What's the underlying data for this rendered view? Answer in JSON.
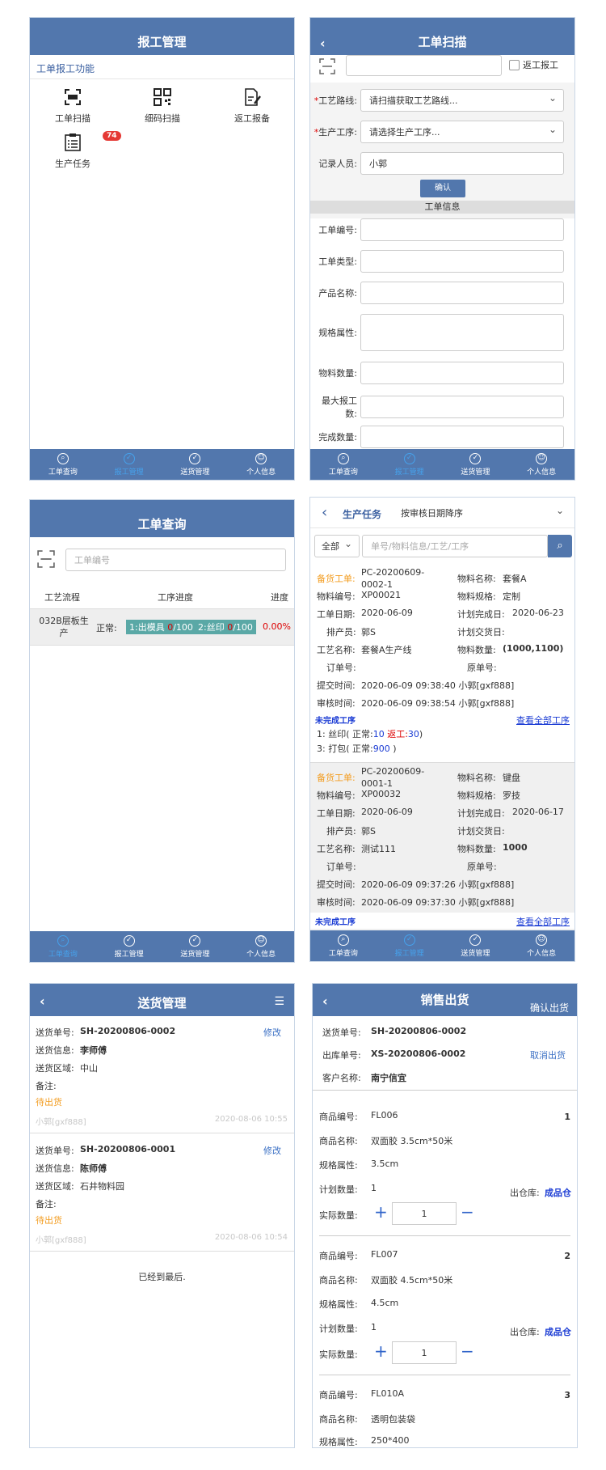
{
  "nav": {
    "tab1": "工单查询",
    "tab2": "报工管理",
    "tab3": "送货管理",
    "tab4": "个人信息"
  },
  "p1": {
    "title": "报工管理",
    "section": "工单报工功能",
    "icons": [
      {
        "label": "工单扫描"
      },
      {
        "label": "细码扫描"
      },
      {
        "label": "返工报备"
      },
      {
        "label": "生产任务",
        "badge": "74"
      }
    ]
  },
  "p2": {
    "title": "工单扫描",
    "rework": "返工报工",
    "route_label": "工艺路线:",
    "route_ph": "请扫描获取工艺路线...",
    "proc_label": "生产工序:",
    "proc_ph": "请选择生产工序...",
    "rec_label": "记录人员:",
    "rec_val": "小郭",
    "confirm": "确认",
    "info": "工单信息",
    "fields": [
      "工单编号:",
      "工单类型:",
      "产品名称:",
      "规格属性:",
      "物料数量:",
      "最大报工数:",
      "完成数量:"
    ]
  },
  "p3": {
    "title": "工单查询",
    "ph": "工单编号",
    "cols": [
      "工艺流程",
      "工序进度",
      "进度"
    ],
    "row": {
      "name": "032B层板生产",
      "state": "正常:",
      "t1a": "1:出模具 ",
      "t1b": "0",
      "t1c": "/100",
      "t2a": "2:丝印 ",
      "t2b": "0",
      "t2c": "/100",
      "pct": "0.00%"
    }
  },
  "p4": {
    "title": "生产任务",
    "sort": "按审核日期降序",
    "filter": "全部",
    "ph": "单号/物料信息/工艺/工序",
    "lab": {
      "bh": "备货工单:",
      "wlmc": "物料名称:",
      "wlbh": "物料编号:",
      "wlgg": "物料规格:",
      "gdrq": "工单日期:",
      "jhwc": "计划完成日:",
      "pcy": "排产员:",
      "jhjh": "计划交货日:",
      "gymc": "工艺名称:",
      "wlsl": "物料数量:",
      "ddh": "订单号:",
      "ydh": "原单号:",
      "tj": "提交时间:",
      "sh": "审核时间:"
    },
    "unfinished": "未完成工序",
    "viewall": "查看全部工序",
    "c1": {
      "no1": "PC-20200609-",
      "no2": "0002-1",
      "wlmc": "套餐A",
      "wlbh": "XP00021",
      "wlgg": "定制",
      "gdrq": "2020-06-09",
      "jhwc": "2020-06-23",
      "pcy": "郭S",
      "gymc": "套餐A生产线",
      "wlsl": "(1000,1100)",
      "tj": "2020-06-09 09:38:40 小郭[gxf888]",
      "sh": "2020-06-09 09:38:54 小郭[gxf888]",
      "p1a": "1: 丝印( 正常:",
      "p1b": "10",
      "p1c": " 返工:",
      "p1d": "30",
      "p1e": ")",
      "p2a": "3: 打包( 正常:",
      "p2b": "900",
      "p2c": " )"
    },
    "c2": {
      "no1": "PC-20200609-",
      "no2": "0001-1",
      "wlmc": "键盘",
      "wlbh": "XP00032",
      "wlgg": "罗技",
      "gdrq": "2020-06-09",
      "jhwc": "2020-06-17",
      "pcy": "郭S",
      "gymc": "测试111",
      "wlsl": "1000",
      "tj": "2020-06-09 09:37:26 小郭[gxf888]",
      "sh": "2020-06-09 09:37:30 小郭[gxf888]"
    }
  },
  "p5": {
    "title": "送货管理",
    "lab": {
      "no": "送货单号:",
      "info": "送货信息:",
      "area": "送货区域:",
      "note": "备注:"
    },
    "edit": "修改",
    "items": [
      {
        "no": "SH-20200806-0002",
        "info": "李师傅",
        "area": "中山",
        "status": "待出货",
        "user": "小郭[gxf888]",
        "time": "2020-08-06 10:55"
      },
      {
        "no": "SH-20200806-0001",
        "info": "陈师傅",
        "area": "石井物料园",
        "status": "待出货",
        "user": "小郭[gxf888]",
        "time": "2020-08-06 10:54"
      }
    ],
    "end": "已经到最后."
  },
  "p6": {
    "title": "销售出货",
    "confirm": "确认出货",
    "cancel": "取消出货",
    "lab": {
      "shdh": "送货单号:",
      "ckdh": "出库单号:",
      "khmc": "客户名称:",
      "spbh": "商品编号:",
      "spmc": "商品名称:",
      "gg": "规格属性:",
      "jh": "计划数量:",
      "sj": "实际数量:",
      "cck": "出仓库:"
    },
    "shdh": "SH-20200806-0002",
    "ckdh": "XS-20200806-0002",
    "khmc": "南宁信宜",
    "wh": "成品仓",
    "items": [
      {
        "idx": "1",
        "code": "FL006",
        "name": "双面胶 3.5cm*50米",
        "spec": "3.5cm",
        "plan": "1",
        "qty": "1"
      },
      {
        "idx": "2",
        "code": "FL007",
        "name": "双面胶 4.5cm*50米",
        "spec": "4.5cm",
        "plan": "1",
        "qty": "1"
      },
      {
        "idx": "3",
        "code": "FL010A",
        "name": "透明包装袋",
        "spec": "250*400"
      }
    ]
  }
}
